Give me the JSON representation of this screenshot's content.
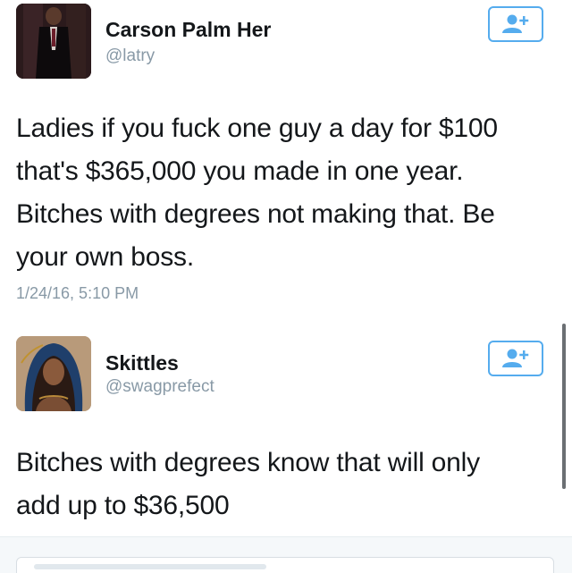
{
  "tweets": [
    {
      "name": "Carson Palm Her",
      "handle": "@latry",
      "text_lines": [
        "Ladies if you fuck one guy a day for $100",
        "that's $365,000 you made in one year.",
        "Bitches with degrees not making that. Be",
        "your own boss."
      ],
      "timestamp": "1/24/16, 5:10 PM",
      "follow_icon": "follow-user-icon"
    },
    {
      "name": "Skittles",
      "handle": "@swagprefect",
      "text_lines": [
        "Bitches with degrees know that will only",
        "add up to $36,500"
      ],
      "follow_icon": "follow-user-icon"
    }
  ],
  "colors": {
    "accent": "#55acee",
    "text": "#14171a",
    "secondary": "#8899a6"
  }
}
